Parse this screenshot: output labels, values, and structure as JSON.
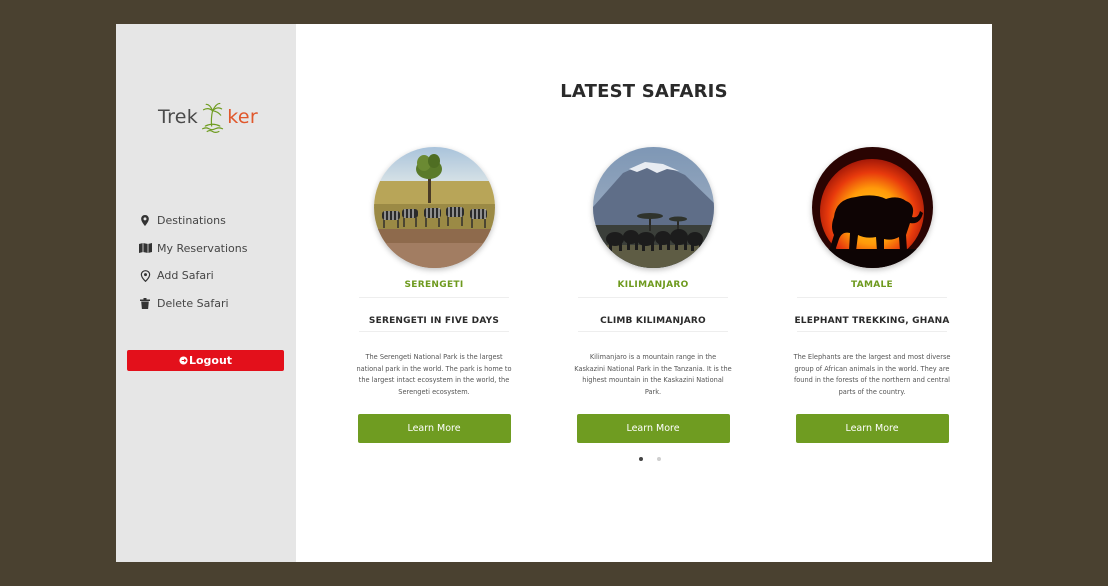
{
  "brand": {
    "logo_part1": "Trek",
    "logo_part2": "ker",
    "accent": "#e0572b"
  },
  "sidebar": {
    "items": [
      {
        "label": "Destinations",
        "icon": "map-pin-icon"
      },
      {
        "label": "My Reservations",
        "icon": "map-book-icon"
      },
      {
        "label": "Add Safari",
        "icon": "location-add-icon"
      },
      {
        "label": "Delete Safari",
        "icon": "trash-icon"
      }
    ],
    "logout_label": "Logout",
    "logout_color": "#e3101b"
  },
  "main": {
    "title": "LATEST SAFARIS",
    "cards": [
      {
        "location": "SERENGETI",
        "title": "SERENGETI IN FIVE DAYS",
        "description": "The Serengeti National Park is the largest national park in the world. The park is home to the largest intact ecosystem in the world, the Serengeti ecosystem.",
        "button": "Learn More",
        "image": "serengeti-zebras-image"
      },
      {
        "location": "KILIMANJARO",
        "title": "CLIMB KILIMANJARO",
        "description": "Kilimanjaro is a mountain range in the Kaskazini National Park in the Tanzania. It is the highest mountain in the Kaskazini National Park.",
        "button": "Learn More",
        "image": "kilimanjaro-elephants-image"
      },
      {
        "location": "TAMALE",
        "title": "ELEPHANT TREKKING, GHANA",
        "description": "The Elephants are the largest and most diverse group of African animals in the world. They are found in the forests of the northern and central parts of the country.",
        "button": "Learn More",
        "image": "elephant-sunset-image"
      }
    ],
    "carousel": {
      "pages": 2,
      "active": 1
    },
    "accent_green": "#6f9c21"
  }
}
